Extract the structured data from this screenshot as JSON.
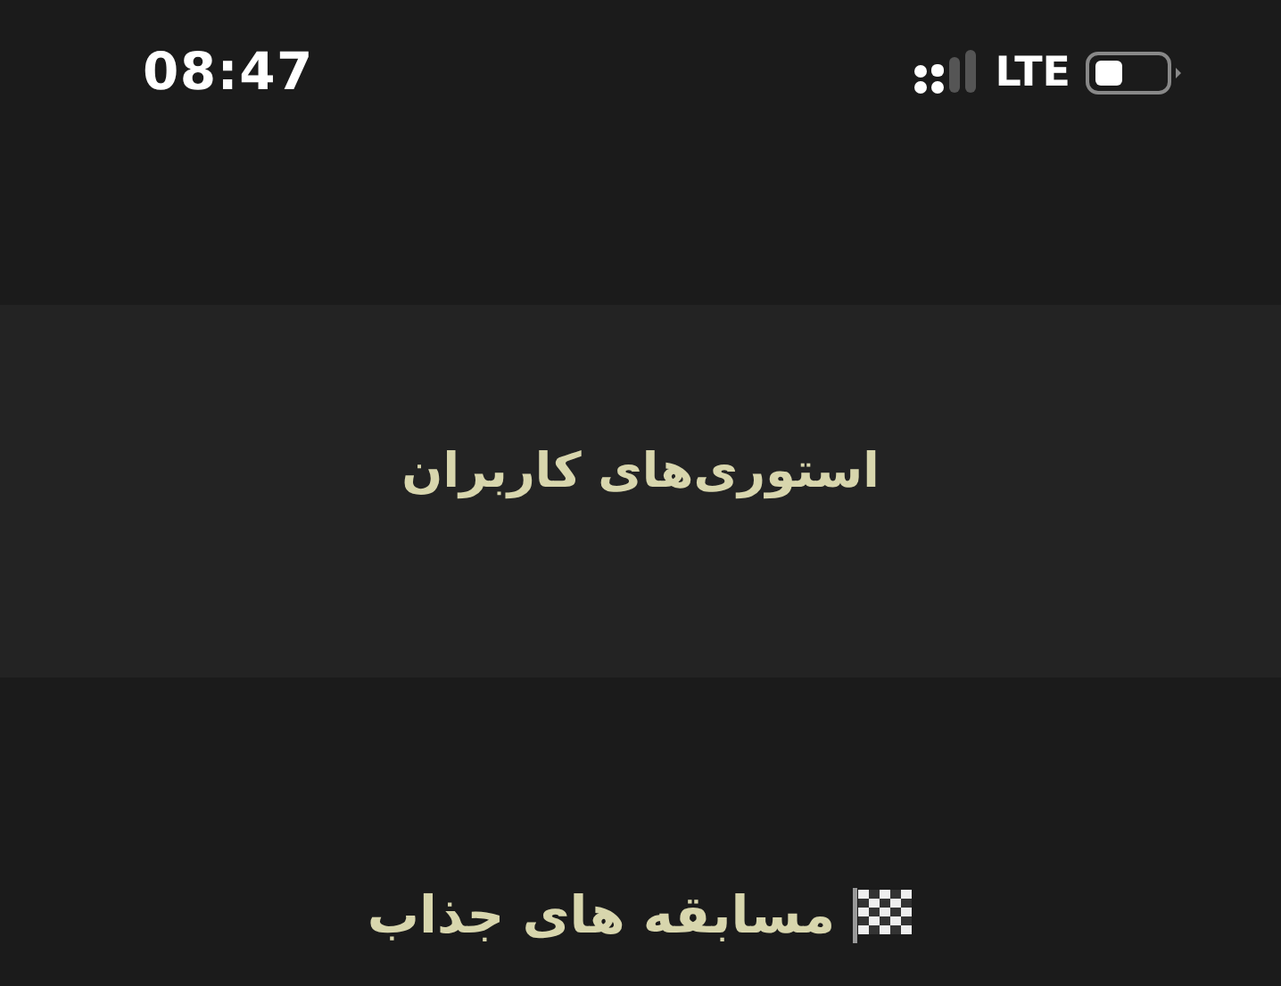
{
  "status_bar": {
    "time": "08:47",
    "network": "LTE"
  },
  "stories_section": {
    "title": "استوری‌های کاربران"
  },
  "contests_section": {
    "title": "مسابقه های جذاب"
  }
}
